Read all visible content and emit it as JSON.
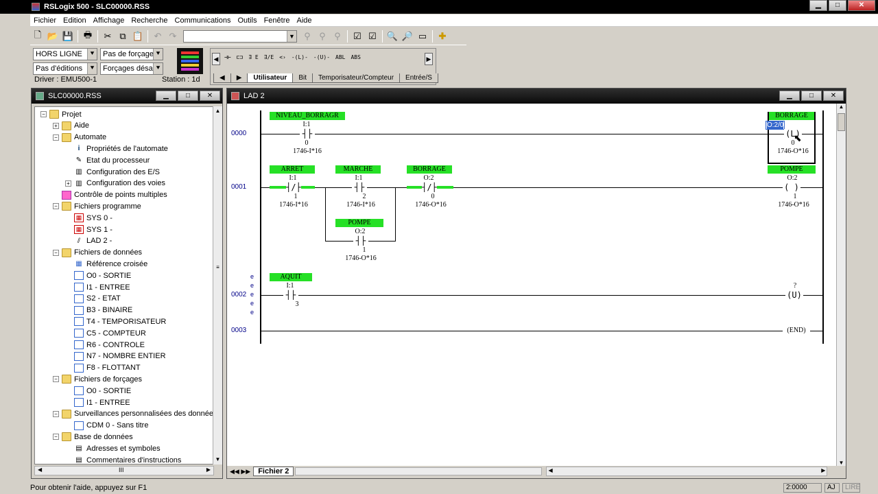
{
  "window": {
    "title": "RSLogix 500 - SLC00000.RSS",
    "min": "▁",
    "max": "□",
    "close": "✕"
  },
  "menu": [
    "Fichier",
    "Edition",
    "Affichage",
    "Recherche",
    "Communications",
    "Outils",
    "Fenêtre",
    "Aide"
  ],
  "status_panel": {
    "mode": "HORS LIGNE",
    "forces": "Pas de forçages",
    "edits": "Pas d'éditions",
    "forces_enabled": "Forçages désacti",
    "driver": "Driver : EMU500-1",
    "station": "Station : 1d"
  },
  "instruction_bar": {
    "symbols": [
      "⊣⊢",
      "⊏⊐",
      "∃ E",
      "∃/E",
      "<›",
      "-(L)-",
      "-(U)-",
      "ABL",
      "ABS"
    ],
    "tabs": [
      "Utilisateur",
      "Bit",
      "Temporisateur/Compteur",
      "Entrée/S"
    ]
  },
  "project": {
    "title": "SLC00000.RSS",
    "nodes": [
      {
        "label": "Projet",
        "level": 0,
        "exp": "−",
        "icon": "folder"
      },
      {
        "label": "Aide",
        "level": 1,
        "exp": "+",
        "icon": "folder"
      },
      {
        "label": "Automate",
        "level": 1,
        "exp": "−",
        "icon": "folder"
      },
      {
        "label": "Propriétés de l'automate",
        "level": 2,
        "exp": "",
        "icon": "info"
      },
      {
        "label": "Etat du processeur",
        "level": 2,
        "exp": "",
        "icon": "pencil"
      },
      {
        "label": "Configuration des E/S",
        "level": 2,
        "exp": "",
        "icon": "io"
      },
      {
        "label": "Configuration des voies",
        "level": 2,
        "exp": "+",
        "icon": "io"
      },
      {
        "label": "Contrôle de points multiples",
        "level": 1,
        "exp": "",
        "icon": "pink"
      },
      {
        "label": "Fichiers programme",
        "level": 1,
        "exp": "−",
        "icon": "folder"
      },
      {
        "label": "SYS 0 -",
        "level": 2,
        "exp": "",
        "icon": "red"
      },
      {
        "label": "SYS 1 -",
        "level": 2,
        "exp": "",
        "icon": "red"
      },
      {
        "label": "LAD 2 -",
        "level": 2,
        "exp": "",
        "icon": "lad"
      },
      {
        "label": "Fichiers de données",
        "level": 1,
        "exp": "−",
        "icon": "folder"
      },
      {
        "label": "Référence croisée",
        "level": 2,
        "exp": "",
        "icon": "xref"
      },
      {
        "label": "O0 - SORTIE",
        "level": 2,
        "exp": "",
        "icon": "file"
      },
      {
        "label": "I1 - ENTREE",
        "level": 2,
        "exp": "",
        "icon": "file"
      },
      {
        "label": "S2 - ETAT",
        "level": 2,
        "exp": "",
        "icon": "file"
      },
      {
        "label": "B3 - BINAIRE",
        "level": 2,
        "exp": "",
        "icon": "file"
      },
      {
        "label": "T4 - TEMPORISATEUR",
        "level": 2,
        "exp": "",
        "icon": "file"
      },
      {
        "label": "C5 - COMPTEUR",
        "level": 2,
        "exp": "",
        "icon": "file"
      },
      {
        "label": "R6 - CONTROLE",
        "level": 2,
        "exp": "",
        "icon": "file"
      },
      {
        "label": "N7 - NOMBRE ENTIER",
        "level": 2,
        "exp": "",
        "icon": "file"
      },
      {
        "label": "F8 - FLOTTANT",
        "level": 2,
        "exp": "",
        "icon": "file"
      },
      {
        "label": "Fichiers de forçages",
        "level": 1,
        "exp": "−",
        "icon": "folder"
      },
      {
        "label": "O0 - SORTIE",
        "level": 2,
        "exp": "",
        "icon": "file"
      },
      {
        "label": "I1 - ENTREE",
        "level": 2,
        "exp": "",
        "icon": "file"
      },
      {
        "label": "Surveillances personnalisées des données",
        "level": 1,
        "exp": "−",
        "icon": "folder"
      },
      {
        "label": "CDM 0 - Sans titre",
        "level": 2,
        "exp": "",
        "icon": "file"
      },
      {
        "label": "Base de données",
        "level": 1,
        "exp": "−",
        "icon": "folder"
      },
      {
        "label": "Adresses et symboles",
        "level": 2,
        "exp": "",
        "icon": "db"
      },
      {
        "label": "Commentaires d'instructions",
        "level": 2,
        "exp": "",
        "icon": "db"
      }
    ],
    "hscroll_thumb": "III"
  },
  "ladder": {
    "title": "LAD 2",
    "rungs": [
      {
        "num": "0000"
      },
      {
        "num": "0001"
      },
      {
        "num": "0002"
      },
      {
        "num": "0003"
      }
    ],
    "r0": {
      "contact_sym": "NIVEAU_BORRAGR",
      "contact_addr": "I:1",
      "contact_bit": "0",
      "contact_mod": "1746-I*16",
      "coil_sym": "BORRAGE",
      "coil_addr": "O:2/0",
      "coil_glyph": "(L)",
      "coil_bit": "0",
      "coil_mod": "1746-O*16"
    },
    "r1": {
      "c1_sym": "ARRET",
      "c1_addr": "I:1",
      "c1_bit": "1",
      "c1_mod": "1746-I*16",
      "c2_sym": "MARCHE",
      "c2_addr": "I:1",
      "c2_bit": "2",
      "c2_mod": "1746-I*16",
      "c3_sym": "BORRAGE",
      "c3_addr": "O:2",
      "c3_bit": "0",
      "c3_mod": "1746-O*16",
      "b_sym": "POMPE",
      "b_addr": "O:2",
      "b_bit": "1",
      "b_mod": "1746-O*16",
      "coil_sym": "POMPE",
      "coil_addr": "O:2",
      "coil_bit": "1",
      "coil_mod": "1746-O*16"
    },
    "r2": {
      "c_sym": "AQUIT",
      "c_addr": "I:1",
      "c_bit": "3",
      "coil_addr": "?",
      "coil_glyph": "(U)",
      "marks": "e\ne\ne\ne\ne"
    },
    "r3": {
      "end": "(END)"
    },
    "file_tab": "Fichier 2"
  },
  "statusbar": {
    "help": "Pour obtenir l'aide, appuyez sur F1",
    "position": "2:0000",
    "mode1": "AJ",
    "mode2": "LIRE"
  }
}
